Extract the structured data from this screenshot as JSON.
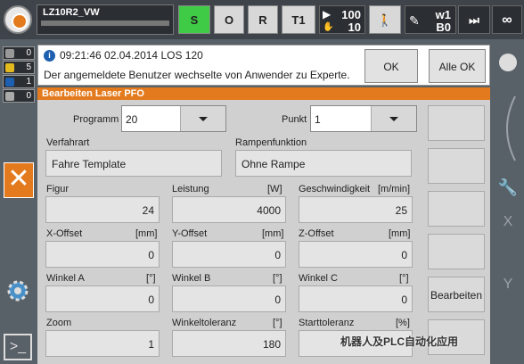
{
  "topbar": {
    "robot_name": "LZ10R2_VW",
    "buttons": {
      "s": "S",
      "o": "O",
      "r": "R",
      "t1": "T1"
    },
    "override_top": "100",
    "override_bottom": "10",
    "tool_top": "w1",
    "tool_bottom": "B0",
    "infinity": "∞"
  },
  "leftbar": {
    "counts": [
      {
        "icon": "error-icon",
        "color": "#999999",
        "value": "0"
      },
      {
        "icon": "warning-icon",
        "color": "#e3b91e",
        "value": "5"
      },
      {
        "icon": "info-icon",
        "color": "#1d5fb0",
        "value": "1"
      },
      {
        "icon": "ack-icon",
        "color": "#aaaaaa",
        "value": "0"
      }
    ]
  },
  "message": {
    "header": "09:21:46 02.04.2014 LOS 120",
    "text": "Der angemeldete Benutzer wechselte von Anwender zu Experte.",
    "ok_label": "OK",
    "all_ok_label": "Alle OK"
  },
  "panel": {
    "title": "Bearbeiten Laser PFO",
    "programm_label": "Programm",
    "programm_value": "20",
    "punkt_label": "Punkt",
    "punkt_value": "1",
    "verfahrart_label": "Verfahrart",
    "verfahrart_value": "Fahre Template",
    "rampen_label": "Rampenfunktion",
    "rampen_value": "Ohne Rampe",
    "fields": [
      {
        "label": "Figur",
        "unit": "",
        "value": "24"
      },
      {
        "label": "Leistung",
        "unit": "[W]",
        "value": "4000"
      },
      {
        "label": "Geschwindigkeit",
        "unit": "[m/min]",
        "value": "25"
      },
      {
        "label": "X-Offset",
        "unit": "[mm]",
        "value": "0"
      },
      {
        "label": "Y-Offset",
        "unit": "[mm]",
        "value": "0"
      },
      {
        "label": "Z-Offset",
        "unit": "[mm]",
        "value": "0"
      },
      {
        "label": "Winkel A",
        "unit": "[°]",
        "value": "0"
      },
      {
        "label": "Winkel B",
        "unit": "[°]",
        "value": "0"
      },
      {
        "label": "Winkel C",
        "unit": "[°]",
        "value": "0"
      },
      {
        "label": "Zoom",
        "unit": "",
        "value": "1"
      },
      {
        "label": "Winkeltoleranz",
        "unit": "[°]",
        "value": "180"
      },
      {
        "label": "Starttoleranz",
        "unit": "[%]",
        "value": ""
      }
    ],
    "bearbeiten_label": "Bearbeiten"
  },
  "rightbar": {
    "x": "X",
    "y": "Y"
  },
  "watermark": "机器人及PLC自动化应用",
  "colors": {
    "accent": "#e37b1e",
    "green": "#3fcb45",
    "info": "#1d5fb0"
  }
}
